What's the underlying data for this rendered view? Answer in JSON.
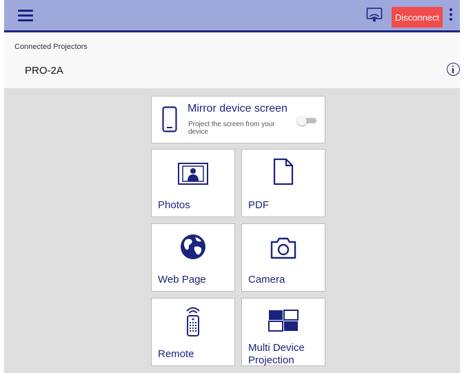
{
  "appbar": {
    "menu_icon": "hamburger-menu-icon",
    "cast_icon": "projector-cast-icon",
    "disconnect_label": "Disconnect",
    "overflow_icon": "more-vertical-icon",
    "accent_color": "#9fa8da",
    "brand_color": "#1a237e",
    "disconnect_color": "#f14b4b"
  },
  "connected": {
    "label": "Connected Projectors",
    "projector_name": "PRO-2A",
    "info_icon": "info-icon"
  },
  "mirror": {
    "title": "Mirror device screen",
    "description": "Project the screen from your device",
    "icon": "smartphone-icon",
    "toggle_on": false
  },
  "tiles": [
    {
      "label": "Photos",
      "icon": "photo-icon"
    },
    {
      "label": "PDF",
      "icon": "document-icon"
    },
    {
      "label": "Web Page",
      "icon": "globe-icon"
    },
    {
      "label": "Camera",
      "icon": "camera-icon"
    },
    {
      "label": "Remote",
      "icon": "remote-control-icon"
    },
    {
      "label": "Multi Device Projection",
      "icon": "multi-device-icon"
    }
  ]
}
